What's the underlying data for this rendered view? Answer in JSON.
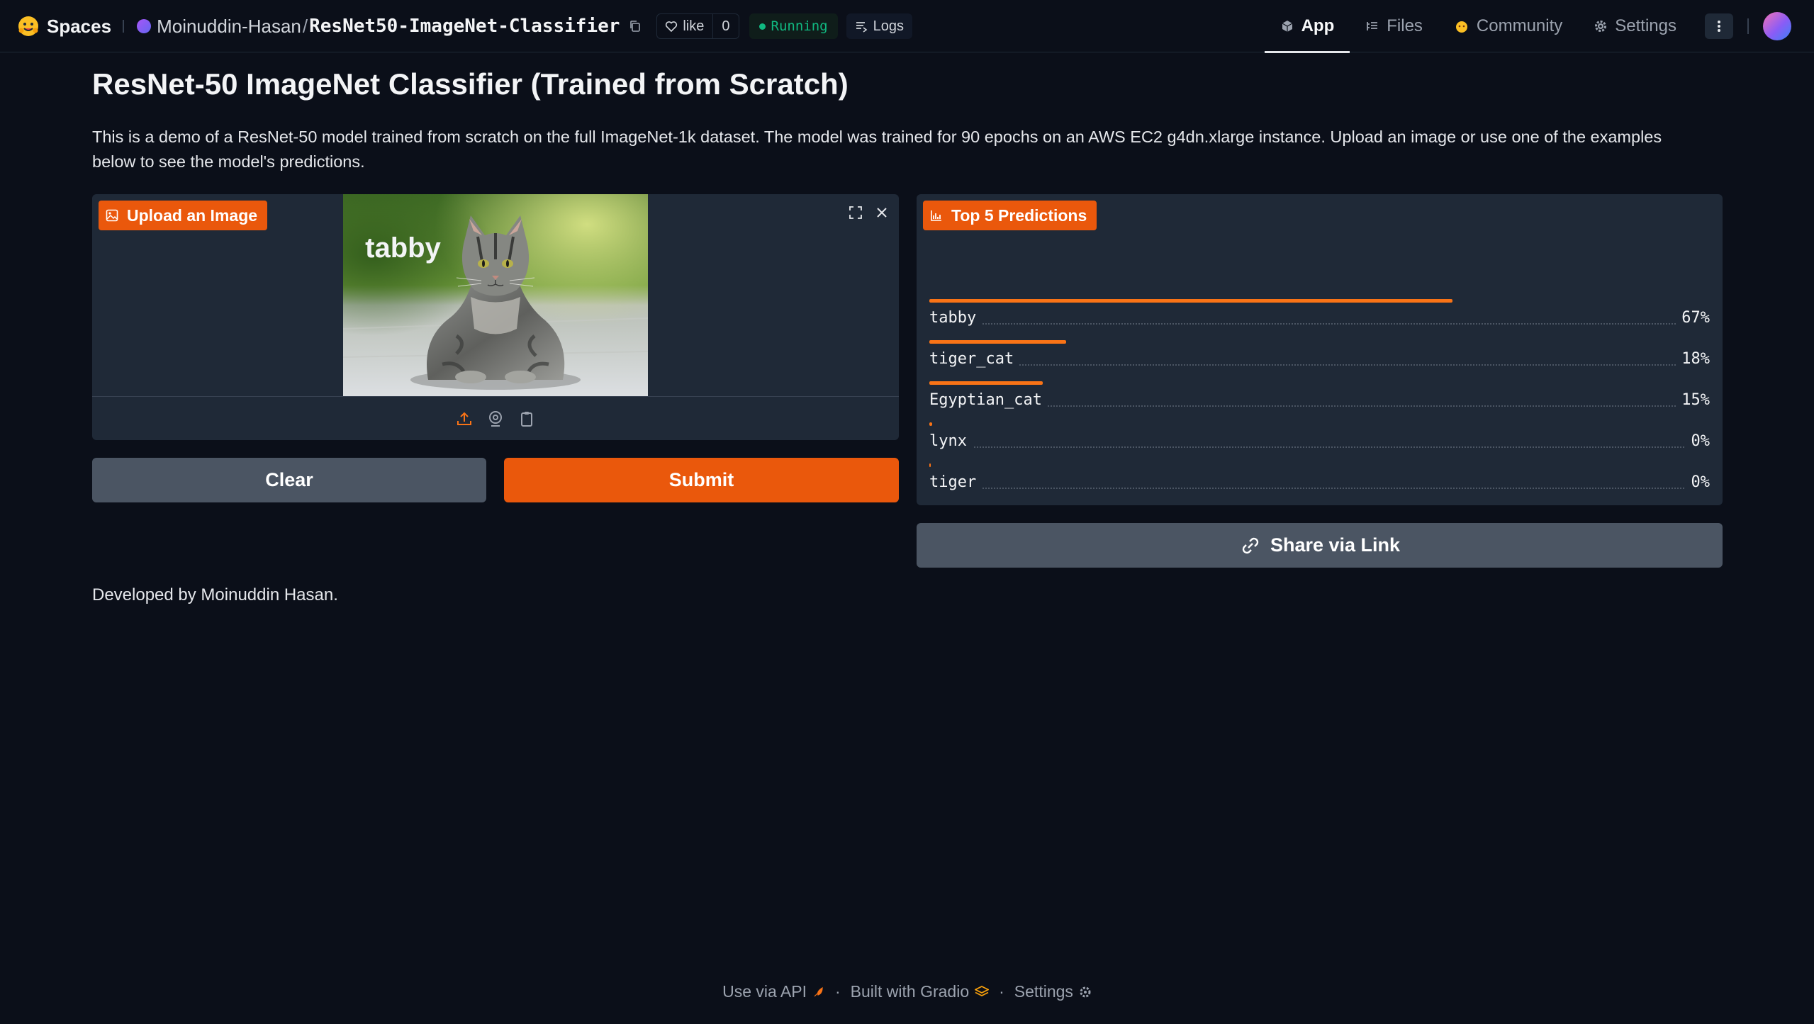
{
  "topbar": {
    "spaces_label": "Spaces",
    "owner": "Moinuddin-Hasan",
    "separator": "/",
    "repo": "ResNet50-ImageNet-Classifier",
    "like_label": "like",
    "like_count": "0",
    "status": "Running",
    "logs_label": "Logs",
    "nav": {
      "app": "App",
      "files": "Files",
      "community": "Community",
      "settings": "Settings"
    }
  },
  "main": {
    "title": "ResNet-50 ImageNet Classifier (Trained from Scratch)",
    "description": "This is a demo of a ResNet-50 model trained from scratch on the full ImageNet-1k dataset. The model was trained for 90 epochs on an AWS EC2 g4dn.xlarge instance. Upload an image or use one of the examples below to see the model's predictions.",
    "upload_label": "Upload an Image",
    "clear_label": "Clear",
    "submit_label": "Submit",
    "predictions_label": "Top 5 Predictions",
    "top_prediction": "tabby",
    "predictions": [
      {
        "label": "tabby",
        "pct": "67%",
        "value": 0.67
      },
      {
        "label": "tiger_cat",
        "pct": "18%",
        "value": 0.175
      },
      {
        "label": "Egyptian_cat",
        "pct": "15%",
        "value": 0.145
      },
      {
        "label": "lynx",
        "pct": "0%",
        "value": 0.004
      },
      {
        "label": "tiger",
        "pct": "0%",
        "value": 0.002
      }
    ],
    "share_label": "Share via Link",
    "developer_note": "Developed by Moinuddin Hasan."
  },
  "footer": {
    "api": "Use via API",
    "built": "Built with Gradio",
    "settings": "Settings",
    "separator": "·"
  },
  "colors": {
    "accent": "#ea580c",
    "bar": "#f97316",
    "running": "#10b981",
    "background": "#0b0f19",
    "panel": "#1f2937"
  }
}
